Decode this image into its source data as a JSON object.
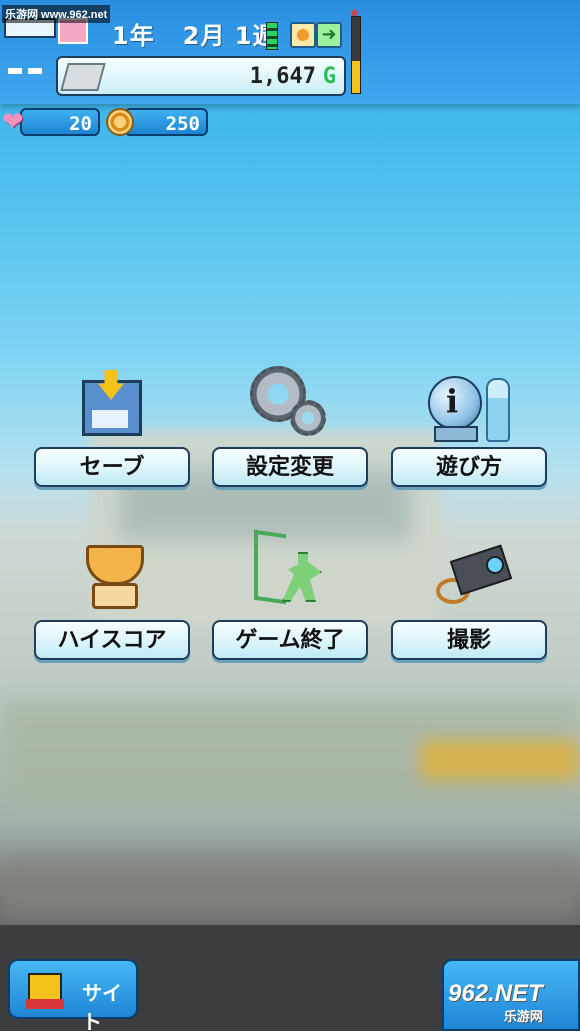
{
  "watermark_top": "乐游网 www.962.net",
  "watermark_bottom": {
    "brand": "962.NET",
    "sub": "乐游网"
  },
  "header": {
    "year": "1年",
    "month": "2月",
    "week": "1週",
    "money": "1,647",
    "money_unit": "G",
    "hearts": "20",
    "coins": "250"
  },
  "menu": {
    "save": "セーブ",
    "settings": "設定変更",
    "howto": "遊び方",
    "highscore": "ハイスコア",
    "quit": "ゲーム終了",
    "photo": "撮影"
  },
  "footer": {
    "site_label": "サイト"
  },
  "colors": {
    "hud_blue": "#3fa7ee",
    "button_face": "#d9f4fb",
    "money_green": "#2fbd52",
    "meter_yellow": "#f4c21a"
  }
}
